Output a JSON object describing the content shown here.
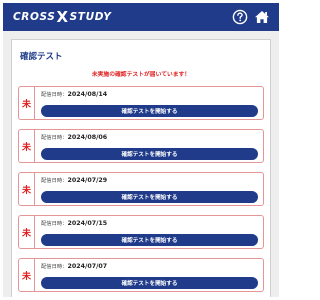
{
  "header": {
    "logo_left": "CROSS",
    "logo_mid": "X",
    "logo_right": "STUDY"
  },
  "page": {
    "title": "確認テスト",
    "alert": "未実施の確認テストが届いています！"
  },
  "tests": [
    {
      "badge": "未",
      "date_label": "配信日時：",
      "date": "2024/08/14",
      "button": "確認テストを開始する"
    },
    {
      "badge": "未",
      "date_label": "配信日時：",
      "date": "2024/08/06",
      "button": "確認テストを開始する"
    },
    {
      "badge": "未",
      "date_label": "配信日時：",
      "date": "2024/07/29",
      "button": "確認テストを開始する"
    },
    {
      "badge": "未",
      "date_label": "配信日時：",
      "date": "2024/07/15",
      "button": "確認テストを開始する"
    },
    {
      "badge": "未",
      "date_label": "配信日時：",
      "date": "2024/07/07",
      "button": "確認テストを開始する"
    }
  ],
  "colors": {
    "brand": "#1f3b8a",
    "alert": "#e02020",
    "item_border": "#e49696"
  },
  "icons": {
    "help": "question-circle-icon",
    "home": "home-icon"
  }
}
